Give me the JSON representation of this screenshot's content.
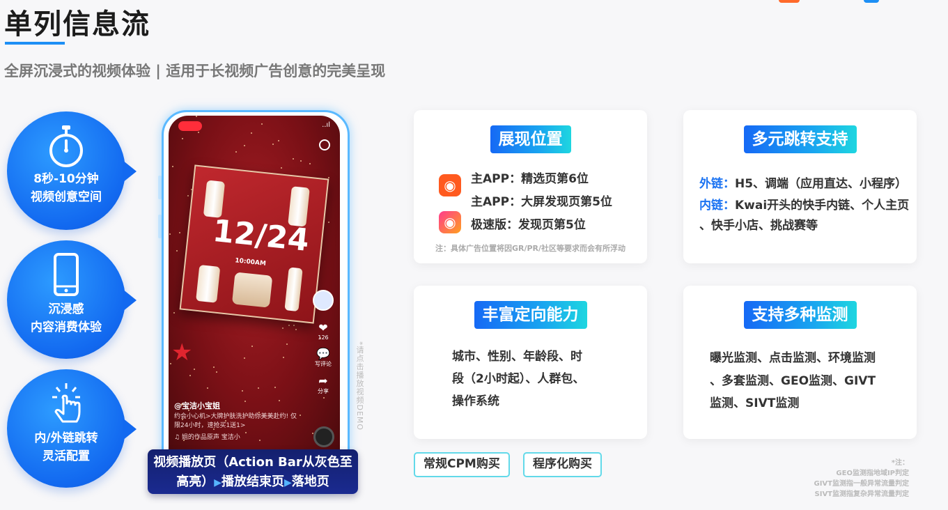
{
  "header": {
    "title": "单列信息流",
    "subtitle": "全屏沉浸式的视频体验 | 适用于长视频广告创意的完美呈现"
  },
  "features": [
    {
      "icon": "stopwatch-icon",
      "line1": "8秒-10分钟",
      "line2": "视频创意空间"
    },
    {
      "icon": "smartphone-icon",
      "line1": "沉浸感",
      "line2": "内容消费体验"
    },
    {
      "icon": "tap-hand-icon",
      "line1": "内/外链跳转",
      "line2": "灵活配置"
    }
  ],
  "phone": {
    "status": "..ıl",
    "card_number": "12/24",
    "card_time": "10:00AM",
    "likes": "126",
    "comment_label": "写评论",
    "share_label": "分享",
    "author": "@宝洁小宝姐",
    "desc": "约会小心机>大牌护肤洗护助你美美赴约! 仅限24小时，速抢买1送1>",
    "music": "♫ 姐的作品原声   宝洁小"
  },
  "demo_hint": "*请点击播放视频DEMO",
  "caption": {
    "line1": "视频播放页（Action Bar从灰色至",
    "line2a": "高亮）",
    "line2b": "播放结束页",
    "line2c": "落地页"
  },
  "placement_card": {
    "tag": "展现位置",
    "rows": [
      "主APP：精选页第6位",
      "主APP：大屏发现页第5位",
      "极速版：发现页第5位"
    ],
    "note": "注：具体广告位置将因GR/PR/社区等要求而会有所浮动"
  },
  "redirect_card": {
    "tag": "多元跳转支持",
    "outer_label": "外链：",
    "outer_text": "H5、调端（应用直达、小程序）",
    "inner_label": "内链：",
    "inner_text": "Kwai开头的快手内链、个人主页",
    "inner_text2": "、快手小店、挑战赛等"
  },
  "targeting_card": {
    "tag": "丰富定向能力",
    "lines": [
      "城市、性别、年龄段、时",
      "段（2小时起）、人群包、",
      "操作系统"
    ]
  },
  "monitoring_card": {
    "tag": "支持多种监测",
    "lines": [
      "曝光监测、点击监测、环境监测",
      "、多套监测、GEO监测、GIVT",
      "监测、SIVT监测"
    ]
  },
  "buy_buttons": [
    "常规CPM购买",
    "程序化购买"
  ],
  "footnote": [
    "*注：",
    "GEO监测指地域IP判定",
    "GIVT监测指一般异常流量判定",
    "SIVT监测指复杂异常流量判定"
  ],
  "colors": {
    "accent": "#1b73f2",
    "brand_orange": "#ff5a1f",
    "caption_bg": "#14206e"
  }
}
